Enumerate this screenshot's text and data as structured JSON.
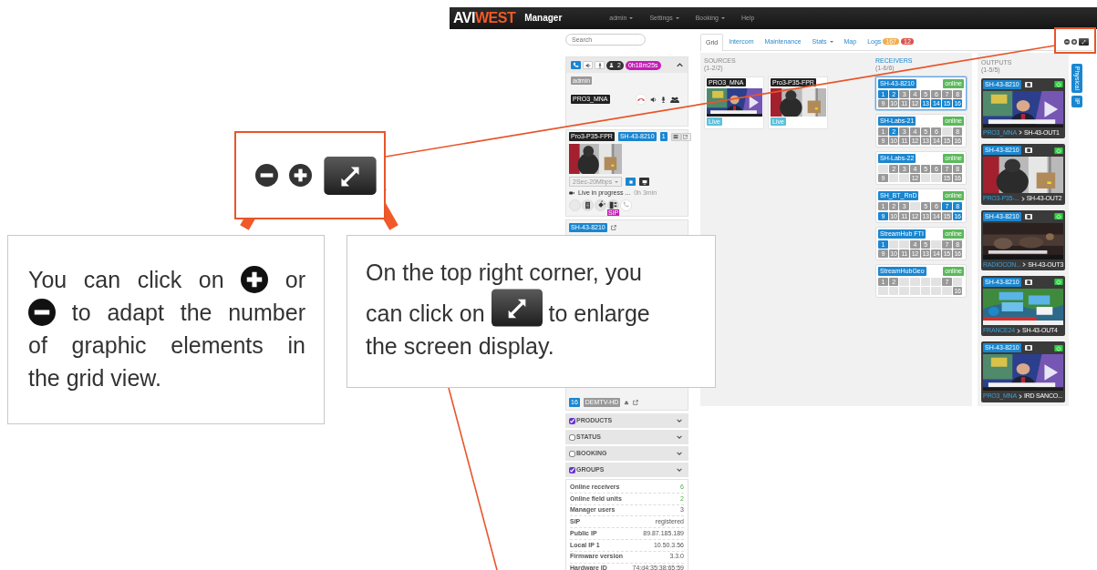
{
  "callouts": {
    "zoom_inset": {
      "buttons": [
        {
          "kind": "minus"
        },
        {
          "kind": "plus"
        },
        {
          "kind": "enlarge"
        }
      ]
    },
    "left_note": {
      "segments": [
        {
          "kind": "text",
          "text": "You can click on"
        },
        {
          "kind": "plus"
        },
        {
          "kind": "text",
          "text": "or"
        },
        {
          "kind": "minus"
        },
        {
          "kind": "text",
          "text": "to adapt the number"
        },
        {
          "kind": "text",
          "text": "of graphic elements in"
        },
        {
          "kind": "text",
          "text": "the grid view."
        }
      ]
    },
    "right_note": {
      "segments": [
        {
          "kind": "text",
          "text": "On the top right corner, you"
        },
        {
          "kind": "text",
          "text": "can click on"
        },
        {
          "kind": "enlarge"
        },
        {
          "kind": "text",
          "text": "to enlarge"
        },
        {
          "kind": "text",
          "text": "the screen display."
        }
      ]
    }
  },
  "app": {
    "logo": [
      {
        "text": "AVI",
        "color": "#ffffff"
      },
      {
        "text": "WEST",
        "color": "#f05a28"
      }
    ],
    "product": "Manager",
    "menu": [
      {
        "label": "admin",
        "dropdown": true
      },
      {
        "label": "Settings",
        "dropdown": true
      },
      {
        "label": "Booking",
        "dropdown": true
      },
      {
        "label": "Help",
        "dropdown": false
      }
    ],
    "search": {
      "placeholder": "Search"
    },
    "intercom": {
      "users": "2",
      "timer": "0h18m25s",
      "operator": "admin",
      "source": "PRO3_MNA"
    },
    "unit": {
      "tags": [
        {
          "text": "Pro3-P35-FPR",
          "kind": "source"
        },
        {
          "text": "SH-43-8210",
          "kind": "receiver"
        },
        {
          "text": "1",
          "kind": "receiver"
        }
      ],
      "profile": "2Sec-20Mbps",
      "status": "Live in progress ...",
      "duration": "0h 3min",
      "sip": "SIP"
    },
    "receiver_card": {
      "name": "SH-43-8210",
      "channel": "16",
      "output": "DEMTV-HD"
    },
    "filters": [
      {
        "label": "PRODUCTS",
        "checked": true
      },
      {
        "label": "STATUS",
        "checked": false
      },
      {
        "label": "BOOKING",
        "checked": false
      },
      {
        "label": "GROUPS",
        "checked": true
      }
    ],
    "info": [
      {
        "label": "Online receivers",
        "value": "6",
        "highlight": true
      },
      {
        "label": "Online field units",
        "value": "2",
        "highlight": true
      },
      {
        "label": "Manager users",
        "value": "3",
        "highlight": false
      },
      {
        "label": "SIP",
        "value": "registered",
        "highlight": false
      },
      {
        "label": "Public IP",
        "value": "89.87.185.189",
        "highlight": false
      },
      {
        "label": "Local IP 1",
        "value": "10.50.3.56",
        "highlight": false
      },
      {
        "label": "Firmware version",
        "value": "3.3.0",
        "highlight": false
      },
      {
        "label": "Hardware ID",
        "value": "74:d4:35:38:65:59",
        "highlight": false
      }
    ],
    "tabs": [
      {
        "label": "Grid",
        "selected": true,
        "dropdown": false
      },
      {
        "label": "Intercom",
        "selected": false,
        "dropdown": false
      },
      {
        "label": "Maintenance",
        "selected": false,
        "dropdown": false
      },
      {
        "label": "Stats",
        "selected": false,
        "dropdown": true
      },
      {
        "label": "Map",
        "selected": false,
        "dropdown": false
      },
      {
        "label": "Logs",
        "selected": false,
        "dropdown": false,
        "badges": [
          {
            "text": "167",
            "color": "#f0ad4e"
          },
          {
            "text": "12",
            "color": "#d9534f"
          }
        ]
      }
    ],
    "sources": {
      "title": "SOURCES",
      "range": "(1-2/2)",
      "items": [
        {
          "name": "PRO3_MNA",
          "status": "Live"
        },
        {
          "name": "Pro3-P35-FPR",
          "status": "Live"
        }
      ]
    },
    "receivers": {
      "title": "RECEIVERS",
      "range": "(1-6/6)",
      "items": [
        {
          "name": "SH-43-8210",
          "status": "online",
          "selected": true,
          "ports": [
            {
              "kind": "port",
              "label": "1",
              "active": true
            },
            {
              "kind": "port",
              "label": "2",
              "active": true
            },
            {
              "kind": "port",
              "label": "3",
              "active": false
            },
            {
              "kind": "port",
              "label": "4",
              "active": false
            },
            {
              "kind": "port",
              "label": "5",
              "active": false
            },
            {
              "kind": "port",
              "label": "6",
              "active": false
            },
            {
              "kind": "port",
              "label": "7",
              "active": false
            },
            {
              "kind": "port",
              "label": "8",
              "active": false
            },
            {
              "kind": "port",
              "label": "9",
              "active": false
            },
            {
              "kind": "port",
              "label": "10",
              "active": false
            },
            {
              "kind": "port",
              "label": "11",
              "active": false
            },
            {
              "kind": "port",
              "label": "12",
              "active": false
            },
            {
              "kind": "port",
              "label": "13",
              "active": true
            },
            {
              "kind": "port",
              "label": "14",
              "active": true
            },
            {
              "kind": "port",
              "label": "15",
              "active": true
            },
            {
              "kind": "port",
              "label": "16",
              "active": true
            }
          ]
        },
        {
          "name": "SH-Labs-21",
          "status": "online",
          "selected": false,
          "ports": [
            {
              "kind": "port",
              "label": "1",
              "active": false
            },
            {
              "kind": "port",
              "label": "2",
              "active": true
            },
            {
              "kind": "port",
              "label": "3",
              "active": false
            },
            {
              "kind": "port",
              "label": "4",
              "active": false
            },
            {
              "kind": "port",
              "label": "5",
              "active": false
            },
            {
              "kind": "port",
              "label": "6",
              "active": false
            },
            {
              "kind": "empty"
            },
            {
              "kind": "port",
              "label": "8",
              "active": false
            },
            {
              "kind": "port",
              "label": "9",
              "active": false
            },
            {
              "kind": "port",
              "label": "10",
              "active": false
            },
            {
              "kind": "port",
              "label": "11",
              "active": false
            },
            {
              "kind": "port",
              "label": "12",
              "active": false
            },
            {
              "kind": "port",
              "label": "13",
              "active": false
            },
            {
              "kind": "port",
              "label": "14",
              "active": false
            },
            {
              "kind": "port",
              "label": "15",
              "active": false
            },
            {
              "kind": "port",
              "label": "16",
              "active": false
            }
          ]
        },
        {
          "name": "SH-Labs-22",
          "status": "online",
          "selected": false,
          "ports": [
            {
              "kind": "empty"
            },
            {
              "kind": "port",
              "label": "2",
              "active": false
            },
            {
              "kind": "port",
              "label": "3",
              "active": false
            },
            {
              "kind": "port",
              "label": "4",
              "active": false
            },
            {
              "kind": "port",
              "label": "5",
              "active": false
            },
            {
              "kind": "port",
              "label": "6",
              "active": false
            },
            {
              "kind": "port",
              "label": "7",
              "active": false
            },
            {
              "kind": "port",
              "label": "8",
              "active": false
            },
            {
              "kind": "port",
              "label": "9",
              "active": false
            },
            {
              "kind": "empty"
            },
            {
              "kind": "empty"
            },
            {
              "kind": "port",
              "label": "12",
              "active": false
            },
            {
              "kind": "empty"
            },
            {
              "kind": "empty"
            },
            {
              "kind": "port",
              "label": "15",
              "active": false
            },
            {
              "kind": "port",
              "label": "16",
              "active": false
            }
          ]
        },
        {
          "name": "SH_BT_RnD",
          "status": "online",
          "selected": false,
          "ports": [
            {
              "kind": "port",
              "label": "1",
              "active": false
            },
            {
              "kind": "port",
              "label": "2",
              "active": false
            },
            {
              "kind": "port",
              "label": "3",
              "active": false
            },
            {
              "kind": "empty"
            },
            {
              "kind": "port",
              "label": "5",
              "active": false
            },
            {
              "kind": "port",
              "label": "6",
              "active": false
            },
            {
              "kind": "port",
              "label": "7",
              "active": true
            },
            {
              "kind": "port",
              "label": "8",
              "active": true
            },
            {
              "kind": "port",
              "label": "9",
              "active": true
            },
            {
              "kind": "port",
              "label": "10",
              "active": false
            },
            {
              "kind": "port",
              "label": "11",
              "active": false
            },
            {
              "kind": "port",
              "label": "12",
              "active": false
            },
            {
              "kind": "port",
              "label": "13",
              "active": false
            },
            {
              "kind": "port",
              "label": "14",
              "active": false
            },
            {
              "kind": "port",
              "label": "15",
              "active": false
            },
            {
              "kind": "port",
              "label": "16",
              "active": true
            }
          ]
        },
        {
          "name": "StreamHub FTI",
          "status": "online",
          "selected": false,
          "ports": [
            {
              "kind": "port",
              "label": "1",
              "active": true
            },
            {
              "kind": "empty"
            },
            {
              "kind": "empty"
            },
            {
              "kind": "port",
              "label": "4",
              "active": false
            },
            {
              "kind": "port",
              "label": "5",
              "active": false
            },
            {
              "kind": "empty"
            },
            {
              "kind": "port",
              "label": "7",
              "active": false
            },
            {
              "kind": "port",
              "label": "8",
              "active": false
            },
            {
              "kind": "port",
              "label": "9",
              "active": false
            },
            {
              "kind": "port",
              "label": "10",
              "active": false
            },
            {
              "kind": "port",
              "label": "11",
              "active": false
            },
            {
              "kind": "port",
              "label": "12",
              "active": false
            },
            {
              "kind": "port",
              "label": "13",
              "active": false
            },
            {
              "kind": "port",
              "label": "14",
              "active": false
            },
            {
              "kind": "port",
              "label": "15",
              "active": false
            },
            {
              "kind": "port",
              "label": "16",
              "active": false
            }
          ]
        },
        {
          "name": "StreamHubGeo",
          "status": "online",
          "selected": false,
          "ports": [
            {
              "kind": "port",
              "label": "1",
              "active": false
            },
            {
              "kind": "port",
              "label": "2",
              "active": false
            },
            {
              "kind": "empty"
            },
            {
              "kind": "empty"
            },
            {
              "kind": "empty"
            },
            {
              "kind": "empty"
            },
            {
              "kind": "port",
              "label": "7",
              "active": false
            },
            {
              "kind": "empty"
            },
            {
              "kind": "empty"
            },
            {
              "kind": "empty"
            },
            {
              "kind": "empty"
            },
            {
              "kind": "empty"
            },
            {
              "kind": "empty"
            },
            {
              "kind": "empty"
            },
            {
              "kind": "empty"
            },
            {
              "kind": "port",
              "label": "16",
              "active": false
            }
          ]
        }
      ]
    },
    "outputs": {
      "title": "OUTPUTS",
      "range": "(1-5/5)",
      "side_tabs": [
        {
          "label": "Physical"
        },
        {
          "label": "IP"
        }
      ],
      "items": [
        {
          "unit": "SH-43-8210",
          "source": "PRO3_MNA",
          "output": "SH-43-OUT1"
        },
        {
          "unit": "SH-43-8210",
          "source": "PRO3-P35-...",
          "output": "SH-43-OUT2"
        },
        {
          "unit": "SH-43-8210",
          "source": "RADIOCON...",
          "output": "SH-43-OUT3"
        },
        {
          "unit": "SH-43-8210",
          "source": "FRANCE24",
          "output": "SH-43-OUT4"
        },
        {
          "unit": "SH-43-8210",
          "source": "PRO3_MNA",
          "output": "IRD SANCO..."
        }
      ]
    }
  }
}
